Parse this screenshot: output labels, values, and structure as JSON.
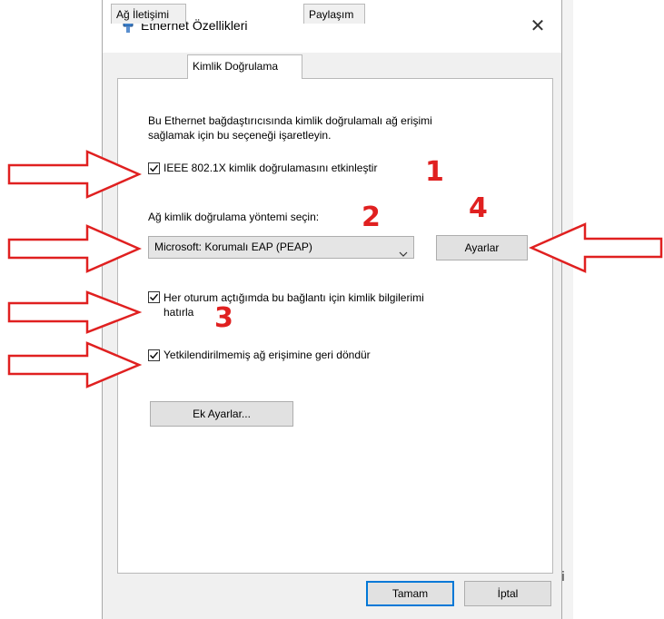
{
  "window": {
    "title": "Ethernet Özellikleri",
    "close_glyph": "✕"
  },
  "tabs": [
    {
      "label": "Ağ İletişimi"
    },
    {
      "label": "Kimlik Doğrulama"
    },
    {
      "label": "Paylaşım"
    }
  ],
  "auth": {
    "description_line1": "Bu Ethernet bağdaştırıcısında kimlik doğrulamalı ağ erişimi",
    "description_line2": "sağlamak için bu seçeneği işaretleyin.",
    "enable_8021x_label": "IEEE 802.1X kimlik doğrulamasını etkinleştir",
    "enable_8021x_checked": true,
    "method_label": "Ağ kimlik doğrulama yöntemi seçin:",
    "method_selected": "Microsoft: Korumalı EAP (PEAP)",
    "settings_button": "Ayarlar",
    "remember_label_line1": "Her oturum açtığımda bu bağlantı için kimlik bilgilerimi",
    "remember_label_line2": "hatırla",
    "remember_checked": true,
    "fallback_label": "Yetkilendirilmemiş ağ erişimine geri döndür",
    "fallback_checked": true,
    "additional_settings_button": "Ek Ayarlar..."
  },
  "footer": {
    "ok_button": "Tamam",
    "cancel_button": "İptal"
  },
  "background": {
    "right_fragment": "i"
  },
  "annotations": {
    "numbers": [
      "1",
      "2",
      "3",
      "4"
    ],
    "color": "#e02020"
  },
  "colors": {
    "dialog_bg": "#f0f0f0",
    "panel_bg": "#ffffff",
    "button_bg": "#e1e1e1",
    "focus_border": "#0078d7",
    "annotation_red": "#e02020"
  }
}
